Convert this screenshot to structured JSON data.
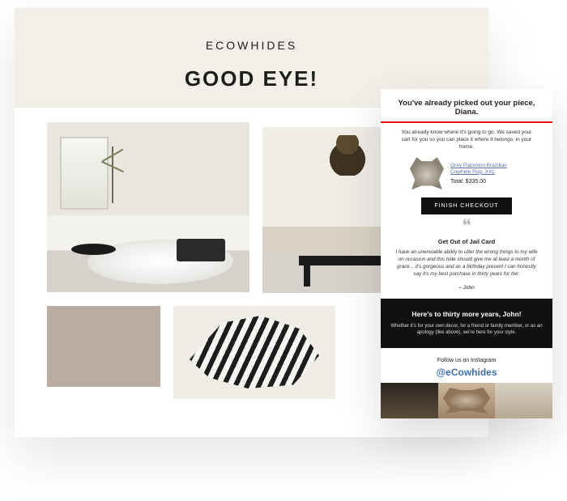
{
  "left_card": {
    "brand": "ECOWHIDES",
    "headline": "GOOD EYE!"
  },
  "right_card": {
    "headline": "You've already picked out your piece, Diana.",
    "subtext": "You already know where it's going to go. We saved your cart for you so you can place it where it belongs: in your home.",
    "product": {
      "name": "Grey Palomino Brazilian Cowhide Rug: XXL",
      "total_label": "Total: $335.00"
    },
    "cta": "FINISH CHECKOUT",
    "testimonial": {
      "title": "Get Out of Jail Card",
      "body": "I have an unenviable ability to utter the wrong things to my wife on occasion and this hide should give me at least a month of grace... it's gorgeous and as a birthday present I can honestly say it's my best purchase in thirty years for her.",
      "author": "– John"
    },
    "banner": {
      "heading": "Here's to thirty more years, John!",
      "body": "Whether it's for your own decor, for a friend or family member, or as an apology (like above), we're here for your style."
    },
    "follow": {
      "label": "Follow us on Instagram",
      "handle": "@eCowhides"
    }
  }
}
